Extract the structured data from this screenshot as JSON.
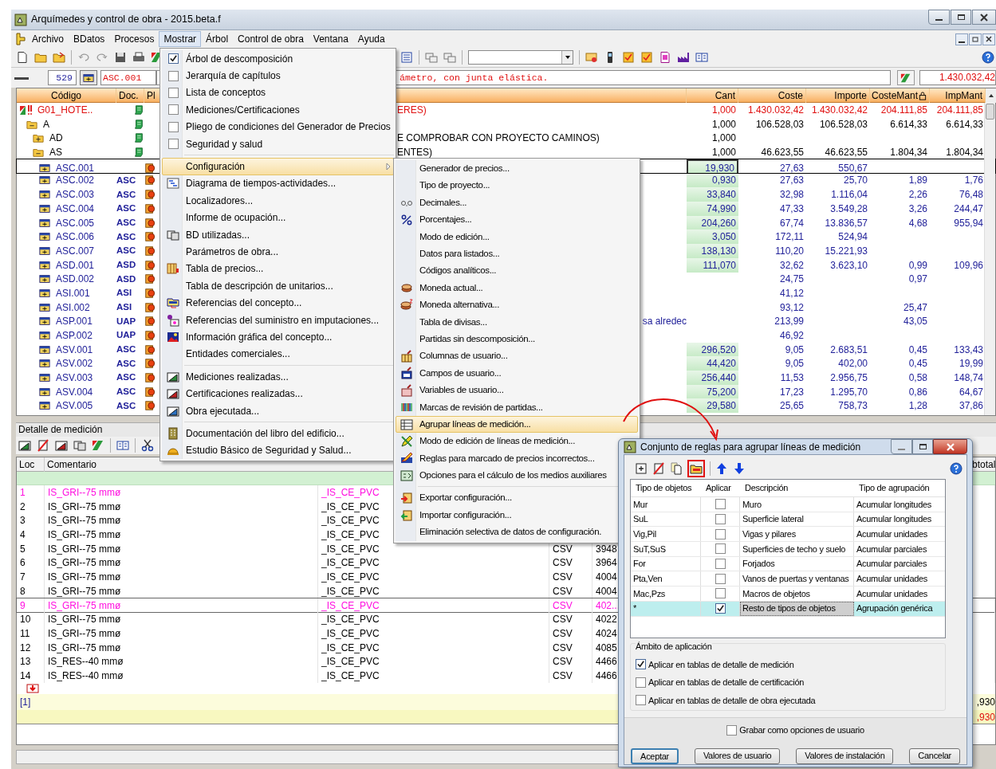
{
  "window": {
    "title": "Arquímedes y control de obra - 2015.beta.f"
  },
  "menu_bar": [
    {
      "label": "Archivo",
      "selected": false
    },
    {
      "label": "BDatos",
      "selected": false
    },
    {
      "label": "Procesos",
      "selected": false
    },
    {
      "label": "Mostrar",
      "selected": true
    },
    {
      "label": "Árbol",
      "selected": false
    },
    {
      "label": "Control de obra",
      "selected": false
    },
    {
      "label": "Ventana",
      "selected": false
    },
    {
      "label": "Ayuda",
      "selected": false
    }
  ],
  "code_bar": {
    "number": "529",
    "code": "ASC.001",
    "description": "ámetro, con junta elástica.",
    "total": "1.430.032,42"
  },
  "tree": {
    "columns": {
      "code": "Código",
      "doc": "Doc.",
      "pl": "Pl",
      "cant": "Cant",
      "coste": "Coste",
      "importe": "Importe",
      "coste_mant": "CosteMant",
      "imp_mant": "ImpMant"
    },
    "nodes": [
      {
        "kind": "root",
        "code": "G01_HOTE..",
        "description": "ERES)",
        "cant": "1,000",
        "coste": "1.430.032,42",
        "importe": "1.430.032,42",
        "coste_mant": "204.111,85",
        "imp_mant": "204.111,85",
        "selected": false,
        "children": [
          {
            "kind": "chapter",
            "code": "A",
            "expanded": true,
            "cant": "1,000",
            "coste": "106.528,03",
            "importe": "106.528,03",
            "coste_mant": "6.614,33",
            "imp_mant": "6.614,33",
            "selected": false,
            "children": [
              {
                "kind": "chapter",
                "code": "AD",
                "expanded": false,
                "description": "E COMPROBAR CON PROYECTO CAMINOS)",
                "cant": "1,000",
                "selected": false
              },
              {
                "kind": "chapter",
                "code": "AS",
                "expanded": true,
                "description": "ENTES)",
                "cant": "1,000",
                "coste": "46.623,55",
                "importe": "46.623,55",
                "coste_mant": "1.804,34",
                "imp_mant": "1.804,34",
                "selected": false,
                "children": [
                  {
                    "kind": "item",
                    "code": "ASC.001",
                    "cant": "19,930",
                    "coste": "27,63",
                    "importe": "550,67",
                    "selected": true
                  },
                  {
                    "kind": "item",
                    "code": "ASC.002",
                    "doc": "ASC",
                    "cant": "0,930",
                    "coste": "27,63",
                    "importe": "25,70",
                    "coste_mant": "1,89",
                    "imp_mant": "1,76",
                    "selected": false
                  },
                  {
                    "kind": "item",
                    "code": "ASC.003",
                    "doc": "ASC",
                    "cant": "33,840",
                    "coste": "32,98",
                    "importe": "1.116,04",
                    "coste_mant": "2,26",
                    "imp_mant": "76,48",
                    "selected": false
                  },
                  {
                    "kind": "item",
                    "code": "ASC.004",
                    "doc": "ASC",
                    "cant": "74,990",
                    "coste": "47,33",
                    "importe": "3.549,28",
                    "coste_mant": "3,26",
                    "imp_mant": "244,47",
                    "selected": false
                  },
                  {
                    "kind": "item",
                    "code": "ASC.005",
                    "doc": "ASC",
                    "cant": "204,260",
                    "coste": "67,74",
                    "importe": "13.836,57",
                    "coste_mant": "4,68",
                    "imp_mant": "955,94",
                    "selected": false
                  },
                  {
                    "kind": "item",
                    "code": "ASC.006",
                    "doc": "ASC",
                    "cant": "3,050",
                    "coste": "172,11",
                    "importe": "524,94",
                    "selected": false
                  },
                  {
                    "kind": "item",
                    "code": "ASC.007",
                    "doc": "ASC",
                    "cant": "138,130",
                    "coste": "110,20",
                    "importe": "15.221,93",
                    "selected": false
                  },
                  {
                    "kind": "item",
                    "code": "ASD.001",
                    "doc": "ASD",
                    "cant": "111,070",
                    "coste": "32,62",
                    "importe": "3.623,10",
                    "coste_mant": "0,99",
                    "imp_mant": "109,96",
                    "selected": false
                  },
                  {
                    "kind": "item",
                    "code": "ASD.002",
                    "doc": "ASD",
                    "coste": "24,75",
                    "coste_mant": "0,97",
                    "selected": false
                  },
                  {
                    "kind": "item",
                    "code": "ASI.001",
                    "doc": "ASI",
                    "coste": "41,12",
                    "selected": false
                  },
                  {
                    "kind": "item",
                    "code": "ASI.002",
                    "doc": "ASI",
                    "coste": "93,12",
                    "coste_mant": "25,47",
                    "selected": false
                  },
                  {
                    "kind": "item",
                    "code": "ASP.001",
                    "doc": "UAP",
                    "description": "sa alredec",
                    "coste": "213,99",
                    "coste_mant": "43,05",
                    "selected": false
                  },
                  {
                    "kind": "item",
                    "code": "ASP.002",
                    "doc": "UAP",
                    "coste": "46,92",
                    "selected": false
                  },
                  {
                    "kind": "item",
                    "code": "ASV.001",
                    "doc": "ASC",
                    "cant": "296,520",
                    "coste": "9,05",
                    "importe": "2.683,51",
                    "coste_mant": "0,45",
                    "imp_mant": "133,43",
                    "selected": false
                  },
                  {
                    "kind": "item",
                    "code": "ASV.002",
                    "doc": "ASC",
                    "cant": "44,420",
                    "coste": "9,05",
                    "importe": "402,00",
                    "coste_mant": "0,45",
                    "imp_mant": "19,99",
                    "selected": false
                  },
                  {
                    "kind": "item",
                    "code": "ASV.003",
                    "doc": "ASC",
                    "cant": "256,440",
                    "coste": "11,53",
                    "importe": "2.956,75",
                    "coste_mant": "0,58",
                    "imp_mant": "148,74",
                    "selected": false
                  },
                  {
                    "kind": "item",
                    "code": "ASV.004",
                    "doc": "ASC",
                    "cant": "75,200",
                    "coste": "17,23",
                    "importe": "1.295,70",
                    "coste_mant": "0,86",
                    "imp_mant": "64,67",
                    "selected": false
                  },
                  {
                    "kind": "item",
                    "code": "ASV.005",
                    "doc": "ASC",
                    "cant": "29,580",
                    "coste": "25,65",
                    "importe": "758,73",
                    "coste_mant": "1,28",
                    "imp_mant": "37,86",
                    "selected": false
                  }
                ]
              }
            ]
          }
        ]
      }
    ]
  },
  "measure_detail": {
    "title": "Detalle de medición",
    "columns": {
      "loc": "Loc",
      "comment": "Comentario",
      "subtotal": "btotal"
    },
    "rows": [
      {
        "loc": "1",
        "comment": "IS_GRI--75 mmø",
        "comment2": "_IS_CE_PVC",
        "marked": true,
        "selected": false
      },
      {
        "loc": "2",
        "comment": "IS_GRI--75 mmø",
        "comment2": "_IS_CE_PVC",
        "marked": false,
        "selected": false
      },
      {
        "loc": "3",
        "comment": "IS_GRI--75 mmø",
        "comment2": "_IS_CE_PVC",
        "marked": false,
        "selected": false
      },
      {
        "loc": "4",
        "comment": "IS_GRI--75 mmø",
        "comment2": "_IS_CE_PVC",
        "marked": false,
        "selected": false
      },
      {
        "loc": "5",
        "comment": "IS_GRI--75 mmø",
        "comment2": "_IS_CE_PVC",
        "type": "CSV",
        "number": "3948",
        "marked": false,
        "selected": false
      },
      {
        "loc": "6",
        "comment": "IS_GRI--75 mmø",
        "comment2": "_IS_CE_PVC",
        "type": "CSV",
        "number": "3964",
        "marked": false,
        "selected": false
      },
      {
        "loc": "7",
        "comment": "IS_GRI--75 mmø",
        "comment2": "_IS_CE_PVC",
        "type": "CSV",
        "number": "4004",
        "marked": false,
        "selected": false
      },
      {
        "loc": "8",
        "comment": "IS_GRI--75 mmø",
        "comment2": "_IS_CE_PVC",
        "type": "CSV",
        "number": "4004",
        "marked": false,
        "selected": false
      },
      {
        "loc": "9",
        "comment": "IS_GRI--75 mmø",
        "comment2": "_IS_CE_PVC",
        "type": "CSV",
        "number": "402...",
        "marked": true,
        "selected": true
      },
      {
        "loc": "10",
        "comment": "IS_GRI--75 mmø",
        "comment2": "_IS_CE_PVC",
        "type": "CSV",
        "number": "4022",
        "marked": false,
        "selected": false
      },
      {
        "loc": "11",
        "comment": "IS_GRI--75 mmø",
        "comment2": "_IS_CE_PVC",
        "type": "CSV",
        "number": "4024",
        "marked": false,
        "selected": false
      },
      {
        "loc": "12",
        "comment": "IS_GRI--75 mmø",
        "comment2": "_IS_CE_PVC",
        "type": "CSV",
        "number": "4085",
        "marked": false,
        "selected": false
      },
      {
        "loc": "13",
        "comment": "IS_RES--40 mmø",
        "comment2": "_IS_CE_PVC",
        "type": "CSV",
        "number": "4466",
        "marked": false,
        "selected": false
      },
      {
        "loc": "14",
        "comment": "IS_RES--40 mmø",
        "comment2": "_IS_CE_PVC",
        "type": "CSV",
        "number": "4466",
        "marked": false,
        "selected": false
      }
    ],
    "footer_label": "[1]",
    "totals": [
      {
        "kind": "total",
        "value": ",930"
      },
      {
        "kind": "difference",
        "value": ",930"
      }
    ]
  },
  "mostrar_menu": {
    "items": [
      {
        "kind": "check",
        "label": "Árbol de descomposición",
        "checked": true,
        "selected": false
      },
      {
        "kind": "check",
        "label": "Jerarquía de capítulos",
        "checked": false,
        "selected": false
      },
      {
        "kind": "check",
        "label": "Lista de conceptos",
        "checked": false,
        "selected": false
      },
      {
        "kind": "check",
        "label": "Mediciones/Certificaciones",
        "checked": false,
        "selected": false
      },
      {
        "kind": "check",
        "label": "Pliego de condiciones del Generador de Precios",
        "checked": false,
        "selected": false
      },
      {
        "kind": "check",
        "label": "Seguridad y salud",
        "checked": false,
        "selected": false
      },
      {
        "kind": "separator"
      },
      {
        "kind": "submenu",
        "label": "Configuración",
        "selected": true
      },
      {
        "kind": "command",
        "label": "Diagrama de tiempos-actividades...",
        "selected": false
      },
      {
        "kind": "command",
        "label": "Localizadores...",
        "selected": false
      },
      {
        "kind": "command",
        "label": "Informe de ocupación...",
        "selected": false
      },
      {
        "kind": "command",
        "label": "BD utilizadas...",
        "selected": false
      },
      {
        "kind": "command",
        "label": "Parámetros de obra...",
        "selected": false
      },
      {
        "kind": "command",
        "label": "Tabla de precios...",
        "selected": false
      },
      {
        "kind": "command",
        "label": "Tabla de descripción de unitarios...",
        "selected": false
      },
      {
        "kind": "command",
        "label": "Referencias del concepto...",
        "selected": false
      },
      {
        "kind": "command",
        "label": "Referencias del suministro en imputaciones...",
        "selected": false
      },
      {
        "kind": "command",
        "label": "Información gráfica del concepto...",
        "selected": false
      },
      {
        "kind": "command",
        "label": "Entidades comerciales...",
        "selected": false
      },
      {
        "kind": "separator"
      },
      {
        "kind": "command",
        "label": "Mediciones realizadas...",
        "selected": false
      },
      {
        "kind": "command",
        "label": "Certificaciones realizadas...",
        "selected": false
      },
      {
        "kind": "command",
        "label": "Obra ejecutada...",
        "selected": false
      },
      {
        "kind": "separator"
      },
      {
        "kind": "command",
        "label": "Documentación del libro del edificio...",
        "selected": false
      },
      {
        "kind": "command",
        "label": "Estudio Básico de Seguridad y Salud...",
        "selected": false
      }
    ]
  },
  "config_submenu": {
    "items": [
      {
        "kind": "command",
        "label": "Generador de precios...",
        "selected": false
      },
      {
        "kind": "command",
        "label": "Tipo de proyecto...",
        "selected": false
      },
      {
        "kind": "command",
        "label": "Decimales...",
        "selected": false
      },
      {
        "kind": "command",
        "label": "Porcentajes...",
        "selected": false
      },
      {
        "kind": "command",
        "label": "Modo de edición...",
        "selected": false
      },
      {
        "kind": "command",
        "label": "Datos para listados...",
        "selected": false
      },
      {
        "kind": "command",
        "label": "Códigos analíticos...",
        "selected": false
      },
      {
        "kind": "command",
        "label": "Moneda actual...",
        "selected": false
      },
      {
        "kind": "command",
        "label": "Moneda alternativa...",
        "selected": false
      },
      {
        "kind": "command",
        "label": "Tabla de divisas...",
        "selected": false
      },
      {
        "kind": "command",
        "label": "Partidas sin descomposición...",
        "selected": false
      },
      {
        "kind": "command",
        "label": "Columnas de usuario...",
        "selected": false
      },
      {
        "kind": "command",
        "label": "Campos de usuario...",
        "selected": false
      },
      {
        "kind": "command",
        "label": "Variables de usuario...",
        "selected": false
      },
      {
        "kind": "command",
        "label": "Marcas de revisión de partidas...",
        "selected": false
      },
      {
        "kind": "command",
        "label": "Agrupar líneas de medición...",
        "selected": true
      },
      {
        "kind": "command",
        "label": "Modo de edición de líneas de medición...",
        "selected": false
      },
      {
        "kind": "command",
        "label": "Reglas para marcado de precios incorrectos...",
        "selected": false
      },
      {
        "kind": "command",
        "label": "Opciones para el cálculo de los medios auxiliares",
        "selected": false
      },
      {
        "kind": "separator"
      },
      {
        "kind": "command",
        "label": "Exportar configuración...",
        "selected": false
      },
      {
        "kind": "command",
        "label": "Importar configuración...",
        "selected": false
      },
      {
        "kind": "command",
        "label": "Eliminación selectiva de datos de configuración.",
        "selected": false
      }
    ]
  },
  "dialog": {
    "title": "Conjunto de reglas para agrupar líneas de medición",
    "columns": [
      "Tipo de objetos",
      "Aplicar",
      "Descripción",
      "Tipo de agrupación"
    ],
    "rules": [
      {
        "type": "Mur",
        "apply": false,
        "description": "Muro",
        "grouping": "Acumular longitudes",
        "selected": false
      },
      {
        "type": "SuL",
        "apply": false,
        "description": "Superficie lateral",
        "grouping": "Acumular longitudes",
        "selected": false
      },
      {
        "type": "Vig,Pil",
        "apply": false,
        "description": "Vigas y pilares",
        "grouping": "Acumular unidades",
        "selected": false
      },
      {
        "type": "SuT,SuS",
        "apply": false,
        "description": "Superficies de techo y suelo",
        "grouping": "Acumular parciales",
        "selected": false
      },
      {
        "type": "For",
        "apply": false,
        "description": "Forjados",
        "grouping": "Acumular parciales",
        "selected": false
      },
      {
        "type": "Pta,Ven",
        "apply": false,
        "description": "Vanos de puertas y ventanas",
        "grouping": "Acumular unidades",
        "selected": false
      },
      {
        "type": "Mac,Pzs",
        "apply": false,
        "description": "Macros de objetos",
        "grouping": "Acumular unidades",
        "selected": false
      },
      {
        "type": "*",
        "apply": true,
        "description": "Resto de tipos de objetos",
        "grouping": "Agrupación genérica",
        "selected": true
      }
    ],
    "scope": {
      "title": "Ámbito de aplicación",
      "options": [
        {
          "label": "Aplicar en tablas de detalle de medición",
          "checked": true
        },
        {
          "label": "Aplicar en tablas de detalle de certificación",
          "checked": false
        },
        {
          "label": "Aplicar en tablas de detalle de obra ejecutada",
          "checked": false
        }
      ]
    },
    "save_user": {
      "label": "Grabar como opciones de usuario",
      "checked": false
    },
    "buttons": [
      {
        "label": "Aceptar",
        "default": true
      },
      {
        "label": "Valores de usuario",
        "default": false
      },
      {
        "label": "Valores de instalación",
        "default": false
      },
      {
        "label": "Cancelar",
        "default": false
      }
    ]
  }
}
